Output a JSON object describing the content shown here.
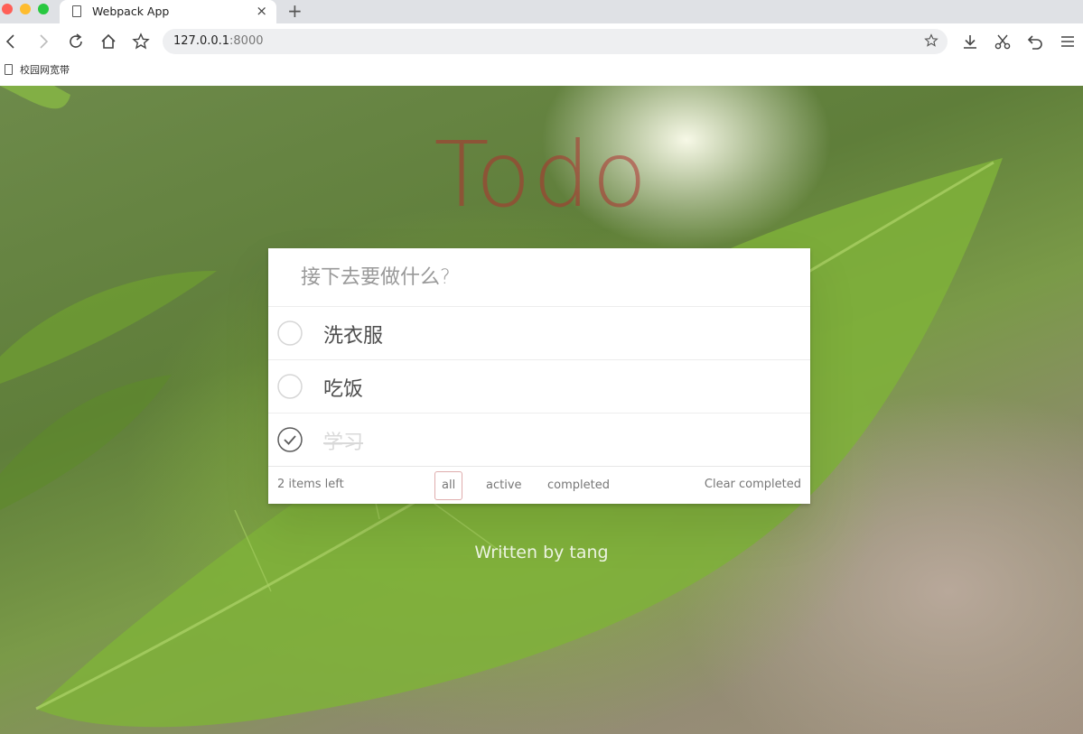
{
  "browser": {
    "tab_title": "Webpack App",
    "close_glyph": "×",
    "newtab_glyph": "+",
    "address_host": "127.0.0.1",
    "address_port": ":8000",
    "bookmark_label": "校园网宽带"
  },
  "app": {
    "logo": "Todo",
    "input_placeholder": "接下去要做什么?",
    "todos": [
      {
        "label": "洗衣服",
        "completed": false
      },
      {
        "label": "吃饭",
        "completed": false
      },
      {
        "label": "学习",
        "completed": true
      }
    ],
    "footer": {
      "count": "2 items left",
      "filters": [
        "all",
        "active",
        "completed"
      ],
      "selected_filter": "all",
      "clear_label": "Clear completed"
    },
    "credit": "Written by tang"
  },
  "colors": {
    "logo": "#af2f2f",
    "accent_border": "#af2f2f",
    "completed_text": "#d9d9d9",
    "check_stroke": "#5a5a5a"
  }
}
